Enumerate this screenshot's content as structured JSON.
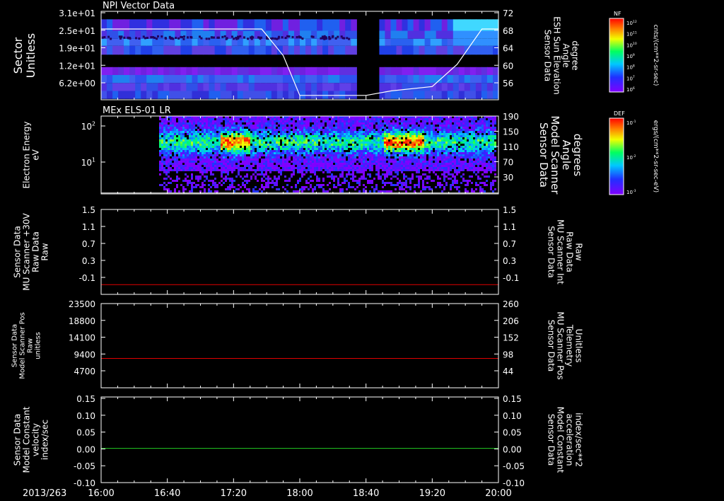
{
  "date_label": "2013/263",
  "time_ticks": [
    "16:00",
    "16:40",
    "17:20",
    "18:00",
    "18:40",
    "19:20",
    "20:00"
  ],
  "colors": {
    "white": "#ffffff",
    "red": "#e00000",
    "green": "#22cc22",
    "black": "#000000"
  },
  "panels": [
    {
      "id": "npi",
      "title": "NPI Vector Data",
      "left_label": [
        "Sector",
        "Unitless"
      ],
      "left_ticks": [
        "3.1e+01",
        "2.5e+01",
        "1.9e+01",
        "1.2e+01",
        "6.2e+00"
      ],
      "right_label": [
        "Sensor Data",
        "ESH Sun Elevation",
        "Angle",
        "degree"
      ],
      "right_ticks": [
        "72",
        "68",
        "64",
        "60",
        "56"
      ],
      "colorbar": {
        "name": "NF",
        "unit": "cnts/(cm**2-sr-sec)",
        "ticks": [
          "10^12",
          "10^11",
          "10^10",
          "10^9",
          "10^8",
          "10^7",
          "10^6"
        ]
      }
    },
    {
      "id": "els",
      "title": "MEx ELS-01 LR",
      "left_label": [
        "Electron Energy",
        "eV"
      ],
      "left_ticks": [
        "10^2",
        "10^1"
      ],
      "right_label": [
        "Sensor Data",
        "Model Scanner",
        "Angle",
        "degrees"
      ],
      "right_ticks": [
        "190",
        "150",
        "110",
        "70",
        "30"
      ],
      "colorbar": {
        "name": "DEF",
        "unit": "ergs/(cm**2-sr-sec-eV)",
        "ticks": [
          "10^-1",
          "10^-2",
          "10^-3"
        ]
      }
    },
    {
      "id": "mu30",
      "title": "",
      "left_label": [
        "Sensor Data",
        "MU Scanner +30V",
        "Raw Data",
        "Raw"
      ],
      "left_ticks": [
        "1.5",
        "1.1",
        "0.7",
        "0.3",
        "-0.1"
      ],
      "right_label": [
        "Sensor Data",
        "MU Scanner Int",
        "Raw Data",
        "Raw"
      ],
      "right_ticks": [
        "1.5",
        "1.1",
        "0.7",
        "0.3",
        "-0.1"
      ]
    },
    {
      "id": "pos",
      "title": "",
      "left_label": [
        "Sensor Data",
        "Model Scanner Pos",
        "Raw",
        "unitless"
      ],
      "left_ticks": [
        "23500",
        "18800",
        "14100",
        "9400",
        "4700"
      ],
      "right_label": [
        "Sensor Data",
        "MU Scanner Pos",
        "Telemetry",
        "Unitless"
      ],
      "right_ticks": [
        "260",
        "206",
        "152",
        "98",
        "44"
      ]
    },
    {
      "id": "vel",
      "title": "",
      "left_label": [
        "Sensor Data",
        "Model Constant",
        "velocity",
        "index/sec"
      ],
      "left_ticks": [
        "0.15",
        "0.10",
        "0.05",
        "0.00",
        "-0.05",
        "-0.10"
      ],
      "right_label": [
        "Sensor Data",
        "Model Constant",
        "acceleration",
        "index/sec**2"
      ],
      "right_ticks": [
        "0.15",
        "0.10",
        "0.05",
        "0.00",
        "-0.05",
        "-0.10"
      ]
    }
  ],
  "chart_data": [
    {
      "type": "heatmap",
      "title": "NPI Vector Data",
      "x_range": [
        "16:00",
        "20:00"
      ],
      "ylabel": "Sector Unitless",
      "ylim": [
        0,
        31
      ],
      "data_gap": [
        "18:35",
        "18:46"
      ],
      "overlay_series": {
        "name": "Sensor Data ESH Sun Elevation Angle",
        "unit": "degree",
        "ylim": [
          52,
          72
        ],
        "x": [
          "16:00",
          "17:37",
          "17:50",
          "18:00",
          "18:40",
          "18:55",
          "19:20",
          "19:35",
          "19:50",
          "20:00"
        ],
        "values": [
          68,
          68,
          62,
          53,
          53,
          54,
          55,
          60,
          68,
          68
        ]
      }
    },
    {
      "type": "heatmap",
      "title": "MEx ELS-01 LR",
      "x_range": [
        "16:00",
        "20:00"
      ],
      "ylabel": "Electron Energy eV",
      "y_log": true,
      "ylim": [
        1,
        200
      ],
      "data_start": "16:35",
      "high_flux_intervals": [
        [
          "17:12",
          "17:30"
        ],
        [
          "18:50",
          "19:15"
        ]
      ],
      "overlay_series": {
        "name": "Sensor Data Model Scanner Angle",
        "unit": "degrees",
        "ylim": [
          10,
          190
        ],
        "x": [
          "16:00",
          "20:00"
        ],
        "values": [
          12,
          12
        ]
      }
    },
    {
      "type": "line",
      "x": [
        "16:00",
        "20:00"
      ],
      "series": [
        {
          "name": "Sensor Data MU Scanner +30V Raw Data",
          "values": [
            -0.05,
            -0.05
          ],
          "color": "#e00000"
        }
      ],
      "ylim": [
        -0.25,
        1.5
      ],
      "right_ylim": [
        -0.25,
        1.5
      ]
    },
    {
      "type": "line",
      "x": [
        "16:00",
        "20:00"
      ],
      "series": [
        {
          "name": "Sensor Data Model Scanner Pos Raw",
          "values": [
            8200,
            8200
          ],
          "color": "#e00000"
        }
      ],
      "ylim": [
        0,
        23500
      ],
      "right_ylim": [
        10,
        260
      ]
    },
    {
      "type": "line",
      "x": [
        "16:00",
        "20:00"
      ],
      "series": [
        {
          "name": "Sensor Data Model Constant velocity",
          "values": [
            0.0,
            0.0
          ],
          "color": "#22cc22"
        }
      ],
      "ylim": [
        -0.1,
        0.15
      ],
      "right_ylim": [
        -0.1,
        0.15
      ]
    }
  ]
}
